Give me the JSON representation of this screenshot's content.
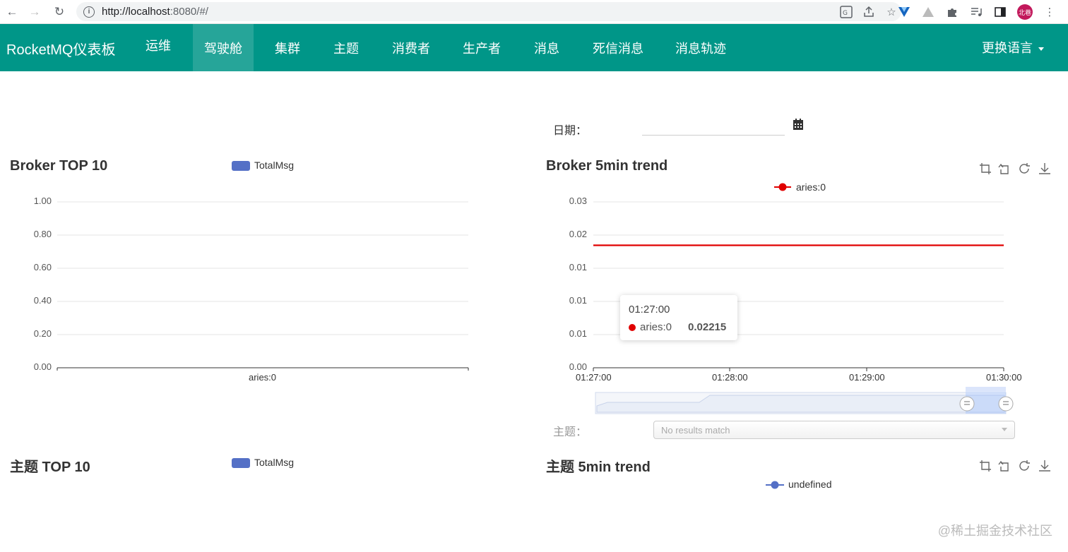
{
  "browser": {
    "url_prefix": "http://localhost",
    "url_rest": ":8080/#/",
    "profile_initials": "北巷"
  },
  "navbar": {
    "brand": "RocketMQ仪表板",
    "items": [
      {
        "label": "运维"
      },
      {
        "label": "驾驶舱",
        "active": true
      },
      {
        "label": "集群"
      },
      {
        "label": "主题"
      },
      {
        "label": "消费者"
      },
      {
        "label": "生产者"
      },
      {
        "label": "消息"
      },
      {
        "label": "死信消息"
      },
      {
        "label": "消息轨迹"
      }
    ],
    "language": "更换语言"
  },
  "date_filter": {
    "label": "日期：",
    "value": ""
  },
  "topic_filter": {
    "label": "主题：",
    "placeholder": "No results match"
  },
  "colors": {
    "navbar": "#009688",
    "series_blue": "#5470c6",
    "series_red": "#e00000"
  },
  "chart_data": [
    {
      "id": "broker-top10",
      "type": "bar",
      "title": "Broker TOP 10",
      "legend": [
        "TotalMsg"
      ],
      "categories": [
        "aries:0"
      ],
      "series": [
        {
          "name": "TotalMsg",
          "values": [
            0
          ]
        }
      ],
      "ylim": [
        0,
        1
      ],
      "yticks": [
        "1.00",
        "0.80",
        "0.60",
        "0.40",
        "0.20",
        "0.00"
      ],
      "grid": true
    },
    {
      "id": "broker-5min-trend",
      "type": "line",
      "title": "Broker 5min trend",
      "legend": [
        "aries:0"
      ],
      "x": [
        "01:27:00",
        "01:28:00",
        "01:29:00",
        "01:30:00"
      ],
      "series": [
        {
          "name": "aries:0",
          "values": [
            0.02215,
            0.02215,
            0.02215,
            0.02215
          ]
        }
      ],
      "ylim": [
        0,
        0.03
      ],
      "yticks": [
        "0.03",
        "0.02",
        "0.01",
        "0.01",
        "0.01",
        "0.00"
      ],
      "tooltip": {
        "time": "01:27:00",
        "series": "aries:0",
        "value": "0.02215"
      },
      "grid": true
    },
    {
      "id": "topic-top10",
      "type": "bar",
      "title": "主题 TOP 10",
      "legend": [
        "TotalMsg"
      ]
    },
    {
      "id": "topic-5min-trend",
      "type": "line",
      "title": "主题 5min trend",
      "legend": [
        "undefined"
      ]
    }
  ],
  "watermark": "@稀土掘金技术社区"
}
